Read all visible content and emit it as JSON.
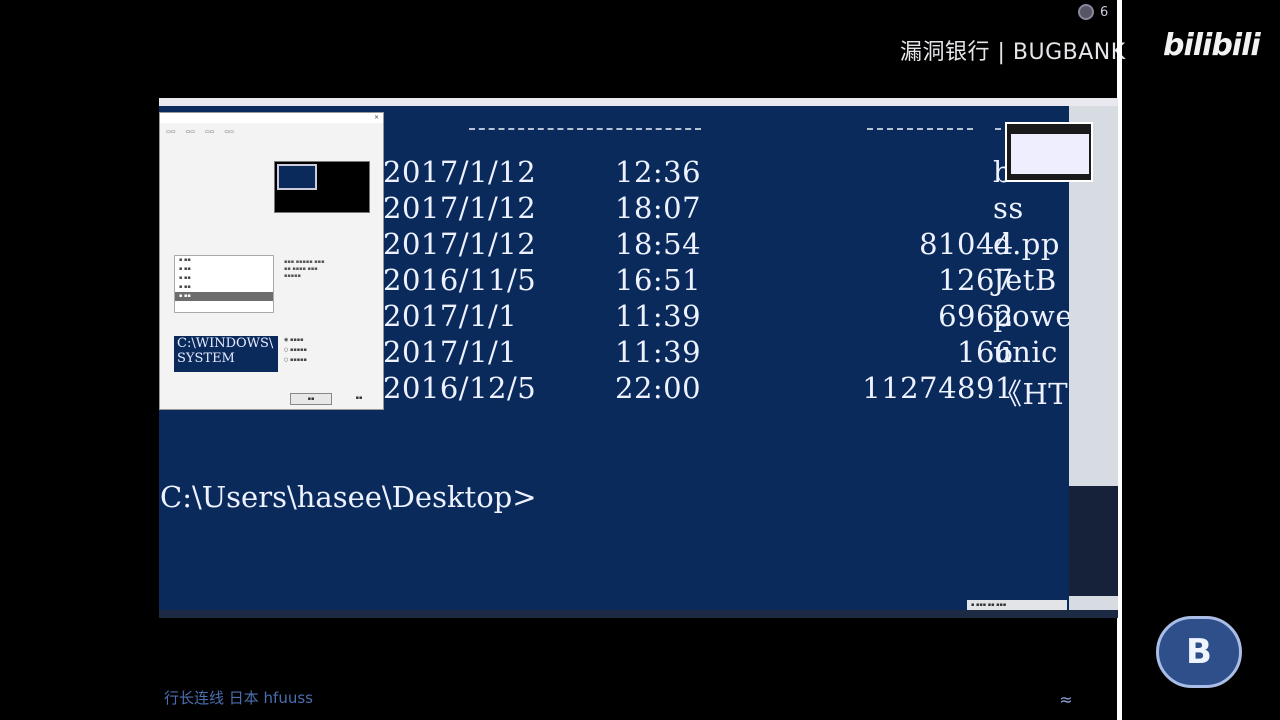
{
  "overlay": {
    "viewer_count": "6",
    "brand_text": "漏洞银行 | BUGBANK",
    "logo_text": "bilibili"
  },
  "console": {
    "rows": [
      {
        "date": "2017/1/12",
        "time": "12:36",
        "size": "",
        "name": "b"
      },
      {
        "date": "2017/1/12",
        "time": "18:07",
        "size": "",
        "name": "ss"
      },
      {
        "date": "2017/1/12",
        "time": "18:54",
        "size": "81044",
        "name": "d.pp"
      },
      {
        "date": "2016/11/5",
        "time": "16:51",
        "size": "1267",
        "name": "JetB"
      },
      {
        "date": "2017/1/1",
        "time": "11:39",
        "size": "6962",
        "name": "powe"
      },
      {
        "date": "2017/1/1",
        "time": "11:39",
        "size": "166",
        "name": "unic"
      },
      {
        "date": "2016/12/5",
        "time": "22:00",
        "size": "11274891",
        "name": "《HT"
      }
    ],
    "prompt": "C:\\Users\\hasee\\Desktop>"
  },
  "dialog": {
    "preview_text": "C:\\WINDOWS\\ SYSTEM"
  },
  "footer": {
    "subtitle": "行长连线 日本 hfuuss"
  },
  "colors": {
    "console_bg": "#0a2a5c",
    "text": "#eef2ff"
  },
  "icons": {
    "viewer": "eye-icon",
    "wave": "wave-icon",
    "bb": "bb-logo-icon"
  }
}
